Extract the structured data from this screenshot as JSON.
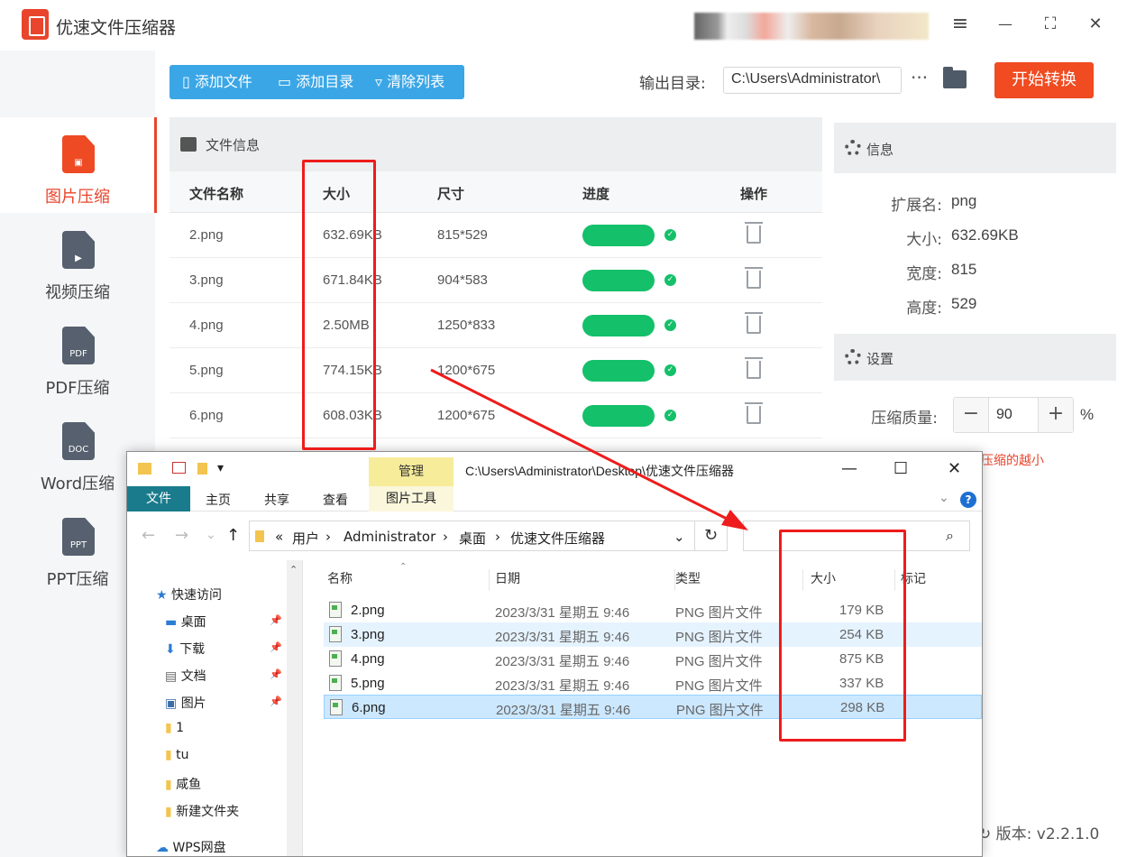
{
  "app": {
    "title": "优速文件压缩器"
  },
  "window_controls": {
    "menu": "≡",
    "minimize": "—",
    "maximize": "⛶",
    "close": "✕"
  },
  "sidebar": {
    "items": [
      {
        "label": "图片压缩",
        "icon": "image-file-icon",
        "tag": "▣",
        "active": true
      },
      {
        "label": "视频压缩",
        "icon": "video-file-icon",
        "tag": "▶",
        "active": false
      },
      {
        "label": "PDF压缩",
        "icon": "pdf-file-icon",
        "tag": "PDF",
        "active": false
      },
      {
        "label": "Word压缩",
        "icon": "word-file-icon",
        "tag": "DOC",
        "active": false
      },
      {
        "label": "PPT压缩",
        "icon": "ppt-file-icon",
        "tag": "PPT",
        "active": false
      }
    ]
  },
  "toolbar": {
    "add_file": "添加文件",
    "add_folder": "添加目录",
    "clear_list": "清除列表",
    "output_label": "输出目录:",
    "output_path": "C:\\Users\\Administrator\\",
    "more": "···",
    "start": "开始转换"
  },
  "file_panel": {
    "title": "文件信息",
    "columns": [
      "文件名称",
      "大小",
      "尺寸",
      "进度",
      "操作"
    ],
    "rows": [
      {
        "name": "2.png",
        "size": "632.69KB",
        "dim": "815*529",
        "progress": 1.0
      },
      {
        "name": "3.png",
        "size": "671.84KB",
        "dim": "904*583",
        "progress": 1.0
      },
      {
        "name": "4.png",
        "size": "2.50MB",
        "dim": "1250*833",
        "progress": 1.0
      },
      {
        "name": "5.png",
        "size": "774.15KB",
        "dim": "1200*675",
        "progress": 1.0
      },
      {
        "name": "6.png",
        "size": "608.03KB",
        "dim": "1200*675",
        "progress": 1.0
      }
    ]
  },
  "info_panel": {
    "title": "信息",
    "fields": [
      {
        "key": "扩展名:",
        "value": "png"
      },
      {
        "key": "大小:",
        "value": "632.69KB"
      },
      {
        "key": "宽度:",
        "value": "815"
      },
      {
        "key": "高度:",
        "value": "529"
      }
    ]
  },
  "settings_panel": {
    "title": "设置",
    "quality_label": "压缩质量:",
    "quality_value": "90",
    "minus": "−",
    "plus": "+",
    "unit": "%",
    "hint": "压缩的越小"
  },
  "version": "版本: v2.2.1.0",
  "explorer": {
    "manage_tab": "管理",
    "title_path": "C:\\Users\\Administrator\\Desktop\\优速文件压缩器",
    "ribbon_tabs": [
      "文件",
      "主页",
      "共享",
      "查看"
    ],
    "tools_tab": "图片工具",
    "help": "?",
    "breadcrumb": [
      "«",
      "用户",
      "Administrator",
      "桌面",
      "优速文件压缩器"
    ],
    "refresh": "↻",
    "nav_tree": [
      {
        "label": "快速访问",
        "pinned": false
      },
      {
        "label": "桌面",
        "pinned": true
      },
      {
        "label": "下载",
        "pinned": true
      },
      {
        "label": "文档",
        "pinned": true
      },
      {
        "label": "图片",
        "pinned": true
      },
      {
        "label": "1",
        "pinned": false
      },
      {
        "label": "tu",
        "pinned": false
      },
      {
        "label": "咸鱼",
        "pinned": false
      },
      {
        "label": "新建文件夹",
        "pinned": false
      },
      {
        "label": "WPS网盘",
        "pinned": false
      }
    ],
    "columns": [
      "名称",
      "日期",
      "类型",
      "大小",
      "标记"
    ],
    "files": [
      {
        "name": "2.png",
        "date": "2023/3/31 星期五 9:46",
        "type": "PNG 图片文件",
        "size": "179 KB"
      },
      {
        "name": "3.png",
        "date": "2023/3/31 星期五 9:46",
        "type": "PNG 图片文件",
        "size": "254 KB"
      },
      {
        "name": "4.png",
        "date": "2023/3/31 星期五 9:46",
        "type": "PNG 图片文件",
        "size": "875 KB"
      },
      {
        "name": "5.png",
        "date": "2023/3/31 星期五 9:46",
        "type": "PNG 图片文件",
        "size": "337 KB"
      },
      {
        "name": "6.png",
        "date": "2023/3/31 星期五 9:46",
        "type": "PNG 图片文件",
        "size": "298 KB"
      }
    ]
  },
  "colors": {
    "accent": "#f04b21",
    "toolbar_blue": "#3aa6e6",
    "progress_green": "#14c06a",
    "annotation_red": "#ee1c1c"
  }
}
